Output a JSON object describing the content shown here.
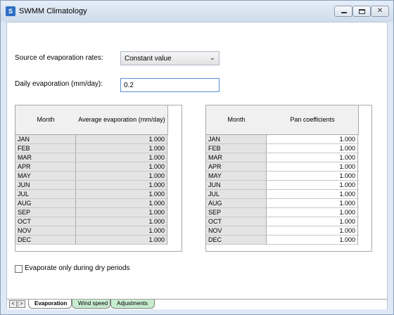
{
  "window": {
    "title": "SWMM Climatology",
    "app_icon": "S"
  },
  "controls": {
    "minimize_icon": "minimize-icon",
    "maximize_icon": "maximize-icon",
    "close_glyph": "✕"
  },
  "evaporation": {
    "source_label": "Source of evaporation rates:",
    "source_value": "Constant value",
    "daily_label": "Daily evaporation (mm/day):",
    "daily_value": "0.2"
  },
  "avg_table": {
    "col_month": "Month",
    "col_value": "Average evaporation (mm/day)",
    "rows": [
      {
        "month": "JAN",
        "value": "1.000"
      },
      {
        "month": "FEB",
        "value": "1.000"
      },
      {
        "month": "MAR",
        "value": "1.000"
      },
      {
        "month": "APR",
        "value": "1.000"
      },
      {
        "month": "MAY",
        "value": "1.000"
      },
      {
        "month": "JUN",
        "value": "1.000"
      },
      {
        "month": "JUL",
        "value": "1.000"
      },
      {
        "month": "AUG",
        "value": "1.000"
      },
      {
        "month": "SEP",
        "value": "1.000"
      },
      {
        "month": "OCT",
        "value": "1.000"
      },
      {
        "month": "NOV",
        "value": "1.000"
      },
      {
        "month": "DEC",
        "value": "1.000"
      }
    ]
  },
  "pan_table": {
    "col_month": "Month",
    "col_value": "Pan coefficients",
    "rows": [
      {
        "month": "JAN",
        "value": "1.000"
      },
      {
        "month": "FEB",
        "value": "1.000"
      },
      {
        "month": "MAR",
        "value": "1.000"
      },
      {
        "month": "APR",
        "value": "1.000"
      },
      {
        "month": "MAY",
        "value": "1.000"
      },
      {
        "month": "JUN",
        "value": "1.000"
      },
      {
        "month": "JUL",
        "value": "1.000"
      },
      {
        "month": "AUG",
        "value": "1.000"
      },
      {
        "month": "SEP",
        "value": "1.000"
      },
      {
        "month": "OCT",
        "value": "1.000"
      },
      {
        "month": "NOV",
        "value": "1.000"
      },
      {
        "month": "DEC",
        "value": "1.000"
      }
    ]
  },
  "dry_only": {
    "label": "Evaporate only during dry periods",
    "checked": false
  },
  "tabs": [
    {
      "label": "Evaporation",
      "active": true
    },
    {
      "label": "Wind speed",
      "active": false
    },
    {
      "label": "Adjustments",
      "active": false
    }
  ],
  "nav": {
    "prev": "<",
    "next": ">"
  }
}
